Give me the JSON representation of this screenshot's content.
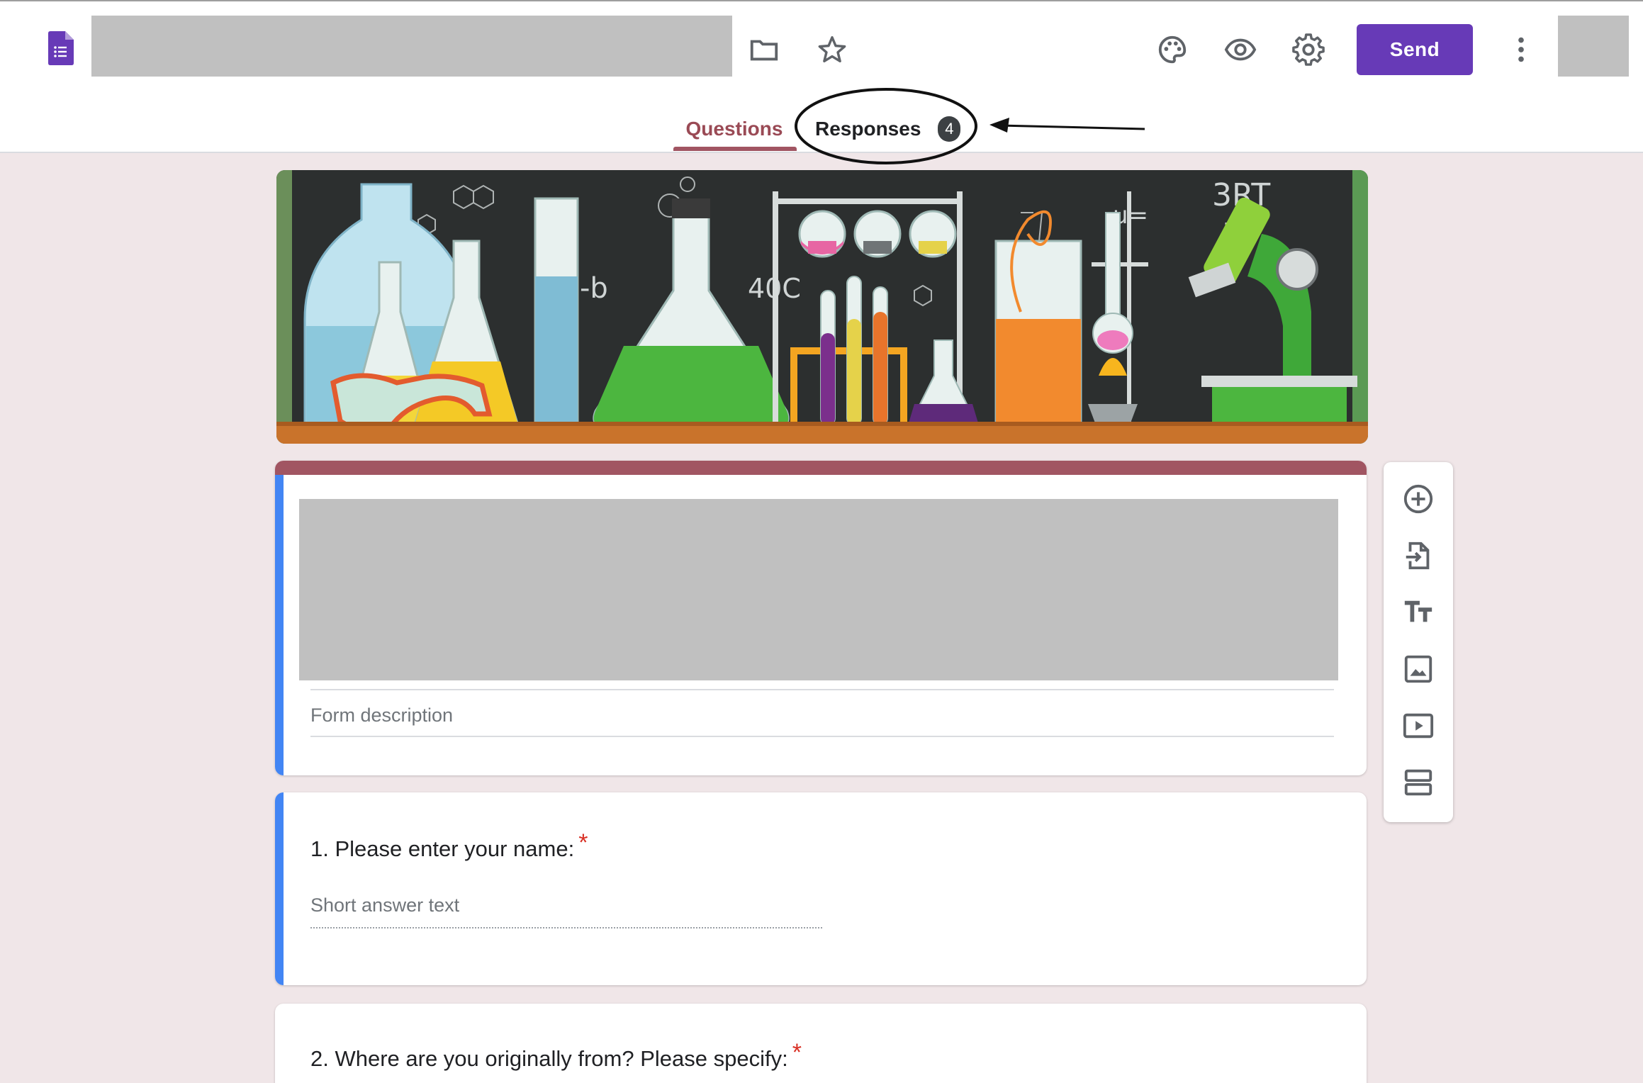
{
  "header": {
    "logo_icon": "google-forms-icon",
    "icons": [
      "folder-icon",
      "star-icon",
      "palette-icon",
      "eye-icon",
      "gear-icon",
      "more-vert-icon"
    ],
    "send_label": "Send"
  },
  "tabs": {
    "questions_label": "Questions",
    "responses_label": "Responses",
    "responses_count": "4"
  },
  "banner": {
    "texts": [
      "-b",
      "40C",
      "3RT",
      "M",
      "u="
    ]
  },
  "form": {
    "description_placeholder": "Form description",
    "questions": [
      {
        "title": "1. Please enter your name:",
        "required_mark": "*",
        "answer_placeholder": "Short answer text"
      },
      {
        "title": "2. Where are you originally from? Please specify:",
        "required_mark": "*"
      }
    ]
  },
  "side_toolbar": {
    "tools": [
      "add-question-icon",
      "import-questions-icon",
      "add-title-icon",
      "add-image-icon",
      "add-video-icon",
      "add-section-icon"
    ]
  },
  "colors": {
    "accent": "#673ab7",
    "theme": "#a15562",
    "active_bar": "#4285f4",
    "background": "#f0e6e8"
  }
}
